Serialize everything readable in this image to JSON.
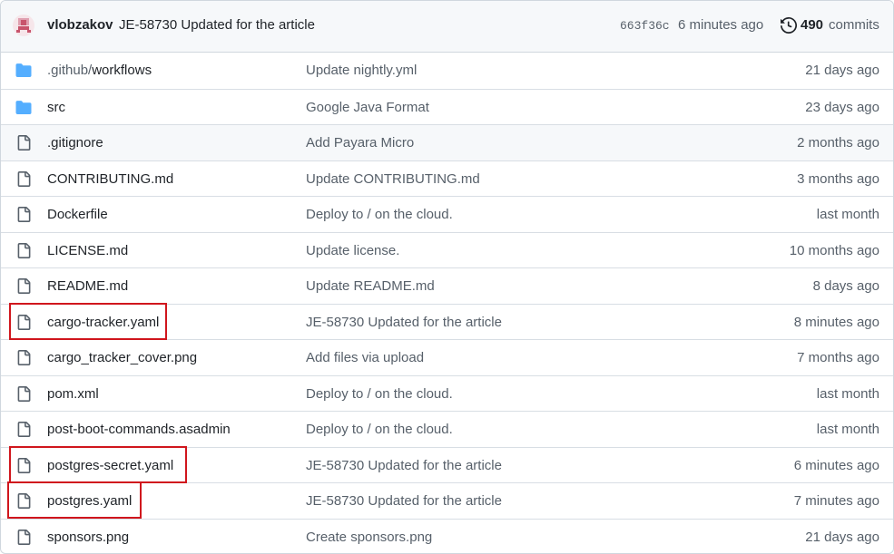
{
  "latest_commit": {
    "author": "vlobzakov",
    "message": "JE-58730 Updated for the article",
    "sha": "663f36c",
    "time": "6 minutes ago",
    "commits_count": "490",
    "commits_label": "commits"
  },
  "files": [
    {
      "type": "folder",
      "name_prefix": ".github/",
      "name": "workflows",
      "message": "Update nightly.yml",
      "age": "21 days ago"
    },
    {
      "type": "folder",
      "name_prefix": "",
      "name": "src",
      "message": "Google Java Format",
      "age": "23 days ago"
    },
    {
      "type": "file",
      "name_prefix": "",
      "name": ".gitignore",
      "message": "Add Payara Micro",
      "age": "2 months ago"
    },
    {
      "type": "file",
      "name_prefix": "",
      "name": "CONTRIBUTING.md",
      "message": "Update CONTRIBUTING.md",
      "age": "3 months ago"
    },
    {
      "type": "file",
      "name_prefix": "",
      "name": "Dockerfile",
      "message": "Deploy to / on the cloud.",
      "age": "last month"
    },
    {
      "type": "file",
      "name_prefix": "",
      "name": "LICENSE.md",
      "message": "Update license.",
      "age": "10 months ago"
    },
    {
      "type": "file",
      "name_prefix": "",
      "name": "README.md",
      "message": "Update README.md",
      "age": "8 days ago"
    },
    {
      "type": "file",
      "name_prefix": "",
      "name": "cargo-tracker.yaml",
      "message": "JE-58730 Updated for the article",
      "age": "8 minutes ago",
      "highlighted": true
    },
    {
      "type": "file",
      "name_prefix": "",
      "name": "cargo_tracker_cover.png",
      "message": "Add files via upload",
      "age": "7 months ago"
    },
    {
      "type": "file",
      "name_prefix": "",
      "name": "pom.xml",
      "message": "Deploy to / on the cloud.",
      "age": "last month"
    },
    {
      "type": "file",
      "name_prefix": "",
      "name": "post-boot-commands.asadmin",
      "message": "Deploy to / on the cloud.",
      "age": "last month"
    },
    {
      "type": "file",
      "name_prefix": "",
      "name": "postgres-secret.yaml",
      "message": "JE-58730 Updated for the article",
      "age": "6 minutes ago",
      "highlighted": true
    },
    {
      "type": "file",
      "name_prefix": "",
      "name": "postgres.yaml",
      "message": "JE-58730 Updated for the article",
      "age": "7 minutes ago",
      "highlighted": true
    },
    {
      "type": "file",
      "name_prefix": "",
      "name": "sponsors.png",
      "message": "Create sponsors.png",
      "age": "21 days ago"
    }
  ],
  "colors": {
    "folder_icon": "#54aeff",
    "file_icon": "#57606a",
    "highlight_border": "#d0161d",
    "header_bg": "#f6f8fa"
  },
  "icons": {
    "folder": "folder-icon",
    "file": "file-icon",
    "history": "history-icon"
  }
}
